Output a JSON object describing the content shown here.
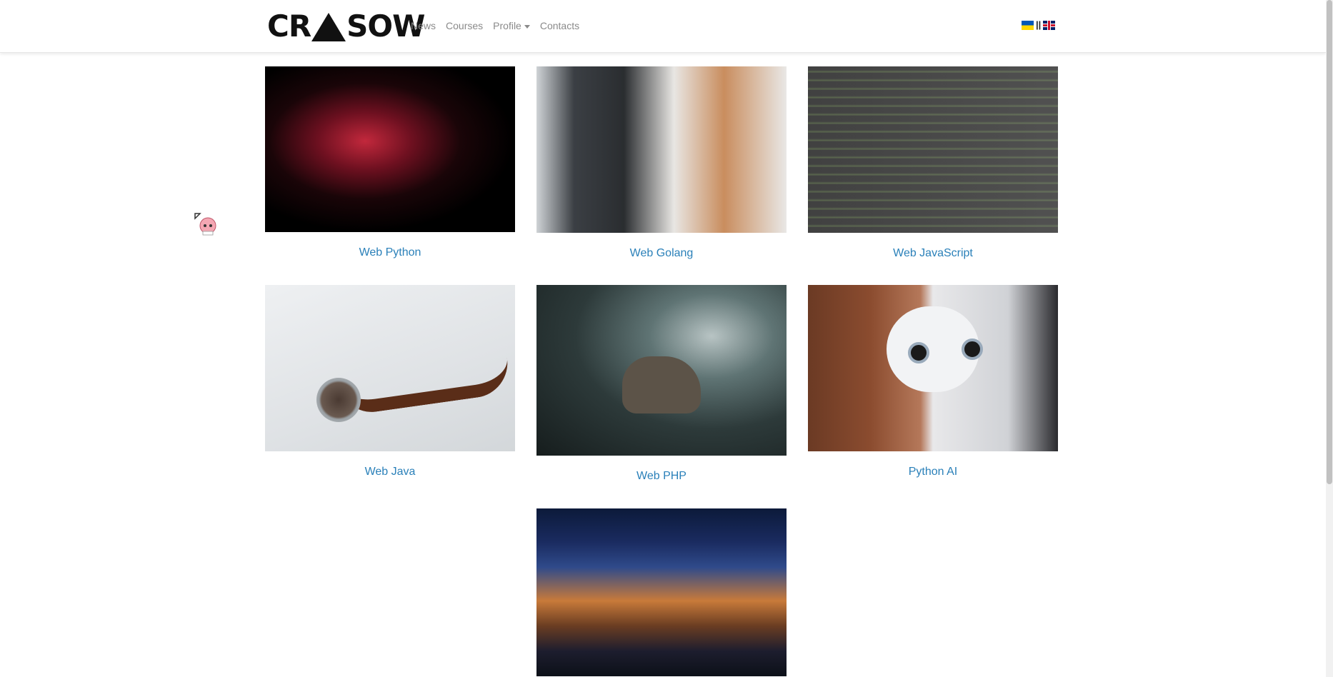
{
  "brand": {
    "logo_text_left": "CR",
    "logo_text_right": "SOW"
  },
  "nav": {
    "links": [
      {
        "label": "News"
      },
      {
        "label": "Courses"
      },
      {
        "label": "Profile"
      },
      {
        "label": "Contacts"
      }
    ]
  },
  "languages": {
    "separator": "||",
    "flags": [
      "ukraine-flag-icon",
      "uk-flag-icon"
    ]
  },
  "courses": [
    {
      "title": "Web Python",
      "image": "red-snake-image"
    },
    {
      "title": "Web Golang",
      "image": "woman-at-computer-image"
    },
    {
      "title": "Web JavaScript",
      "image": "code-screen-image"
    },
    {
      "title": "Web Java",
      "image": "coffee-beans-image"
    },
    {
      "title": "Web PHP",
      "image": "elephant-forest-image"
    },
    {
      "title": "Python AI",
      "image": "robot-image"
    },
    {
      "title": "",
      "image": "container-ship-image"
    }
  ],
  "colors": {
    "link": "#2a80b9",
    "nav_text": "#8a8a8a"
  }
}
